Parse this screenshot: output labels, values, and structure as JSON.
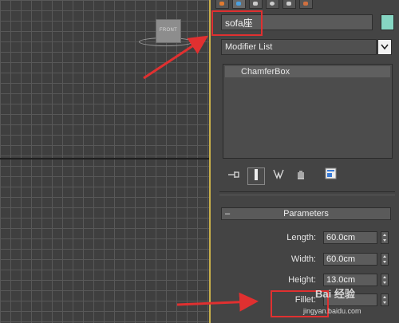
{
  "viewport": {
    "viewcube_label": "FRONT"
  },
  "command_panel": {
    "tab_icons": [
      "create-icon",
      "modify-icon",
      "hierarchy-icon",
      "motion-icon",
      "display-icon",
      "utilities-icon"
    ],
    "object_name": "sofa座",
    "object_color": "#86d6c3",
    "modifier_list_label": "Modifier List",
    "modifier_stack": [
      "ChamferBox"
    ],
    "stack_toolbar_icons": [
      "pin-stack-icon",
      "show-end-result-icon",
      "make-unique-icon",
      "remove-modifier-icon",
      "configure-modifier-sets-icon"
    ]
  },
  "parameters": {
    "title": "Parameters",
    "collapse_symbol": "–",
    "length": {
      "label": "Length:",
      "value": "60.0cm"
    },
    "width": {
      "label": "Width:",
      "value": "60.0cm"
    },
    "height": {
      "label": "Height:",
      "value": "13.0cm"
    },
    "fillet": {
      "label": "Fillet:",
      "value": ""
    }
  },
  "annotation_color": "#e03030",
  "watermark": {
    "brand": "Bai 经验",
    "url": "jingyan.baidu.com"
  }
}
